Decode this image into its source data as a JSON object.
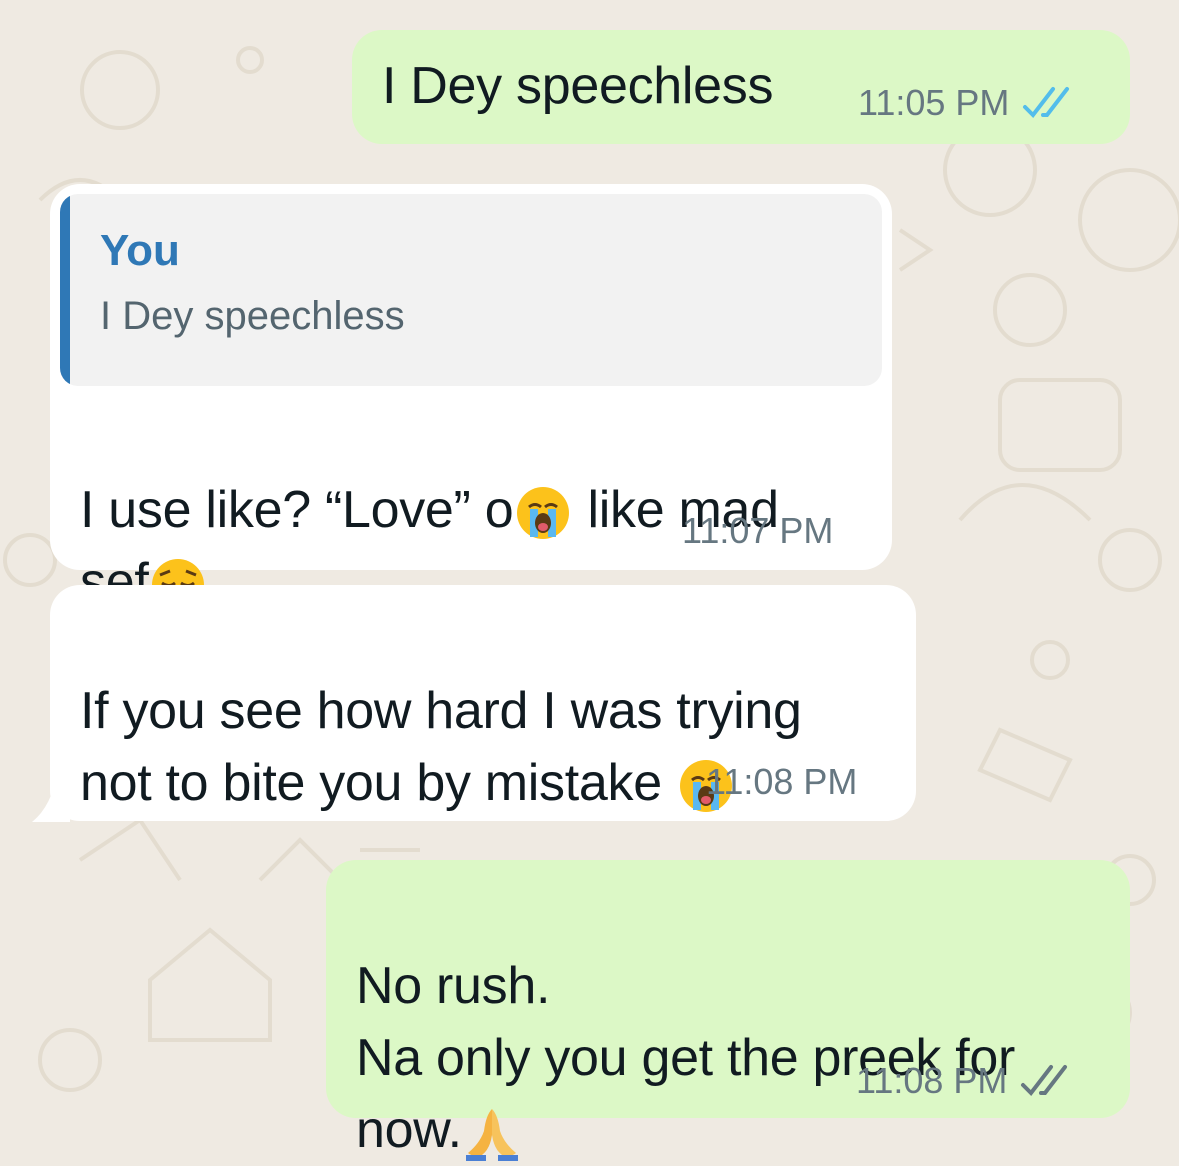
{
  "chat": {
    "messages": [
      {
        "direction": "outgoing",
        "text": "I Dey speechless",
        "time": "11:05 PM",
        "status": "read",
        "status_icon": "double-check-icon"
      },
      {
        "direction": "incoming",
        "reply_to": {
          "author": "You",
          "text": "I Dey speechless"
        },
        "text_parts": [
          "I use like? “Love” o",
          " like mad",
          "sef"
        ],
        "emojis": [
          "loudly-crying-face-emoji",
          "pensive-face-emoji"
        ],
        "time": "11:07 PM"
      },
      {
        "direction": "incoming",
        "text_parts": [
          "If you see how hard I was trying",
          "not to bite you by mistake "
        ],
        "emojis": [
          "loudly-crying-face-emoji"
        ],
        "time": "11:08 PM"
      },
      {
        "direction": "outgoing",
        "text_parts": [
          "No rush.",
          "Na only you get the preek for",
          "now."
        ],
        "emojis": [
          "folded-hands-emoji"
        ],
        "time": "11:08 PM",
        "status": "delivered",
        "status_icon": "double-check-icon"
      }
    ]
  },
  "colors": {
    "outgoing_bubble": "#dcf8c6",
    "incoming_bubble": "#ffffff",
    "background": "#efeae2",
    "read_tick": "#53bdeb",
    "delivered_tick": "#667781",
    "quote_accent": "#2f78b6"
  }
}
